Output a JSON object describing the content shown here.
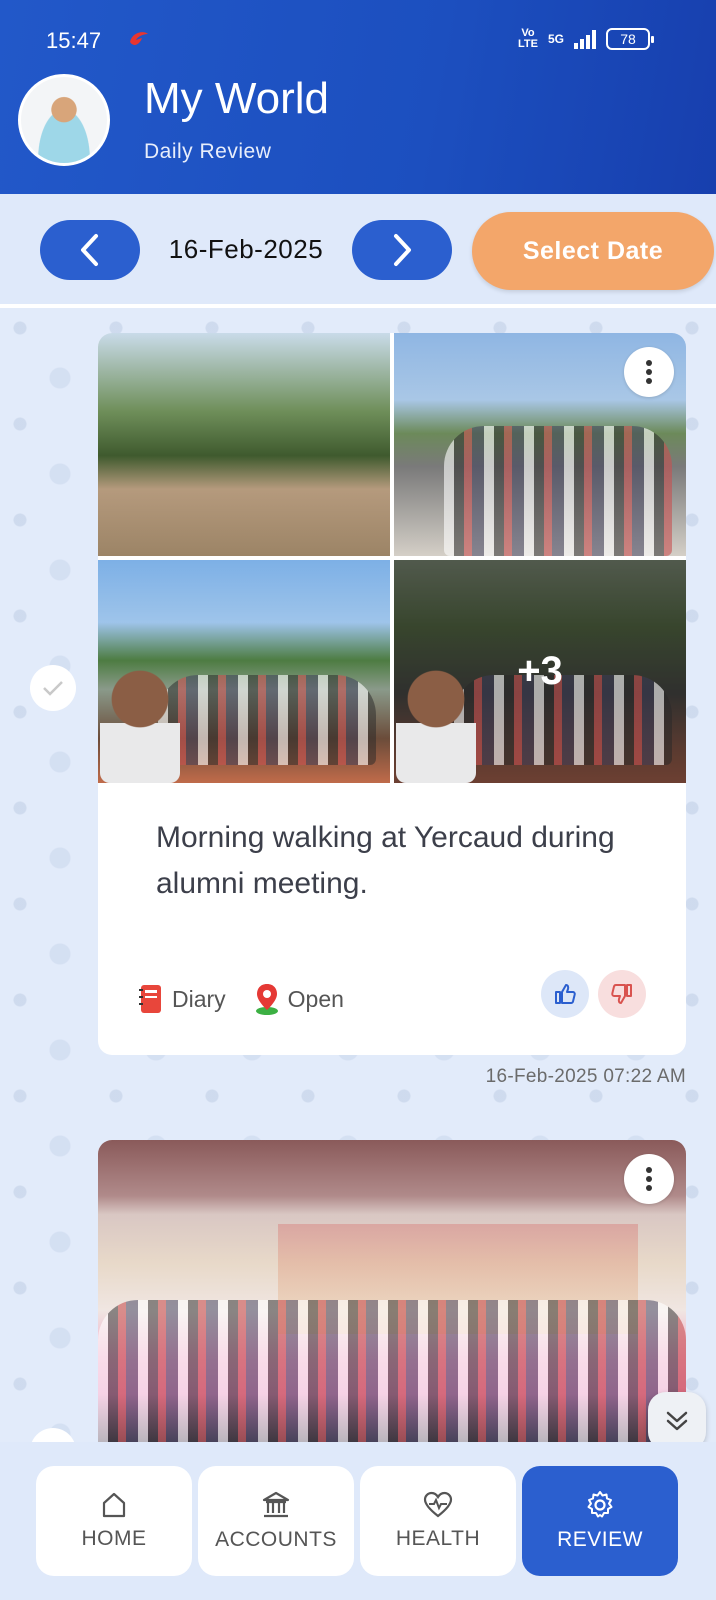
{
  "status": {
    "time": "15:47",
    "volte_top": "Vo",
    "volte_bottom": "LTE",
    "network": "5G",
    "battery": "78"
  },
  "header": {
    "title": "My World",
    "subtitle": "Daily Review"
  },
  "datebar": {
    "date": "16-Feb-2025",
    "select_label": "Select Date"
  },
  "posts": [
    {
      "more_photos": "+3",
      "caption": "Morning walking at Yercaud during alumni meeting.",
      "category": "Diary",
      "location": "Open",
      "timestamp": "16-Feb-2025 07:22 AM"
    }
  ],
  "bottom_nav": {
    "home": "HOME",
    "accounts": "ACCOUNTS",
    "health": "HEALTH",
    "review": "REVIEW"
  },
  "colors": {
    "header_blue": "#1c4fbf",
    "nav_blue": "#2b5fcf",
    "select_orange": "#f3a66a",
    "background": "#dfe9fa"
  },
  "icons": {
    "prev": "chevron-left-icon",
    "next": "chevron-right-icon",
    "diary": "notebook-icon",
    "location": "map-pin-icon",
    "like": "thumbs-up-icon",
    "dislike": "thumbs-down-icon",
    "scroll": "double-chevron-down-icon"
  }
}
